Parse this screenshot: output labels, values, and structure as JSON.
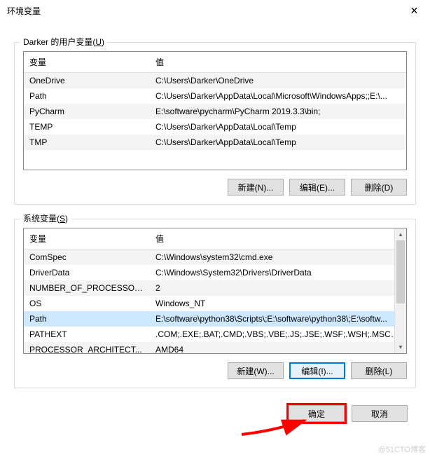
{
  "window": {
    "title": "环境变量",
    "close": "✕"
  },
  "user_section": {
    "label_prefix": "Darker 的用户变量(",
    "label_hotkey": "U",
    "label_suffix": ")",
    "col_name": "变量",
    "col_value": "值",
    "rows": [
      {
        "name": "OneDrive",
        "value": "C:\\Users\\Darker\\OneDrive"
      },
      {
        "name": "Path",
        "value": "C:\\Users\\Darker\\AppData\\Local\\Microsoft\\WindowsApps;;E:\\..."
      },
      {
        "name": "PyCharm",
        "value": "E:\\software\\pycharm\\PyCharm 2019.3.3\\bin;"
      },
      {
        "name": "TEMP",
        "value": "C:\\Users\\Darker\\AppData\\Local\\Temp"
      },
      {
        "name": "TMP",
        "value": "C:\\Users\\Darker\\AppData\\Local\\Temp"
      }
    ],
    "buttons": {
      "new": "新建(N)...",
      "edit": "编辑(E)...",
      "delete": "删除(D)"
    }
  },
  "system_section": {
    "label_prefix": "系统变量(",
    "label_hotkey": "S",
    "label_suffix": ")",
    "col_name": "变量",
    "col_value": "值",
    "rows": [
      {
        "name": "ComSpec",
        "value": "C:\\Windows\\system32\\cmd.exe"
      },
      {
        "name": "DriverData",
        "value": "C:\\Windows\\System32\\Drivers\\DriverData"
      },
      {
        "name": "NUMBER_OF_PROCESSORS",
        "value": "2"
      },
      {
        "name": "OS",
        "value": "Windows_NT"
      },
      {
        "name": "Path",
        "value": "E:\\software\\python38\\Scripts\\;E:\\software\\python38\\;E:\\softw..."
      },
      {
        "name": "PATHEXT",
        "value": ".COM;.EXE;.BAT;.CMD;.VBS;.VBE;.JS;.JSE;.WSF;.WSH;.MSC;.PY;.P..."
      },
      {
        "name": "PROCESSOR_ARCHITECT...",
        "value": "AMD64"
      }
    ],
    "buttons": {
      "new": "新建(W)...",
      "edit": "编辑(I)...",
      "delete": "删除(L)"
    }
  },
  "dialog_buttons": {
    "ok": "确定",
    "cancel": "取消"
  },
  "watermark": "@51CTO博客"
}
